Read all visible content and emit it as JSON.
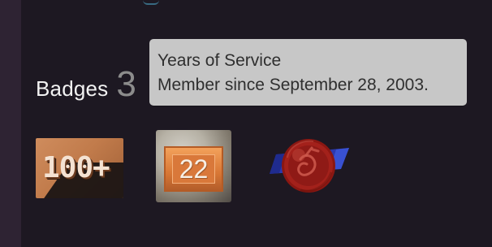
{
  "badges": {
    "title": "Badges",
    "count": "3",
    "items": [
      {
        "name": "100+",
        "label": "100+",
        "icon": "badge-100-icon",
        "accent": "#c17b4b"
      },
      {
        "name": "years-of-service",
        "label": "22",
        "icon": "badge-years-icon",
        "accent": "#d9783a"
      },
      {
        "name": "wax-seal",
        "icon": "badge-wax-seal-icon",
        "accent": "#9e1f1a"
      }
    ]
  },
  "tooltip": {
    "line1": "Years of Service",
    "line2": "Member since September 28, 2003."
  },
  "colors": {
    "background": "#2a1f2e",
    "panel": "#1d1822",
    "tooltip_bg": "#c7c7c7",
    "tooltip_text": "#2f2f2f"
  }
}
